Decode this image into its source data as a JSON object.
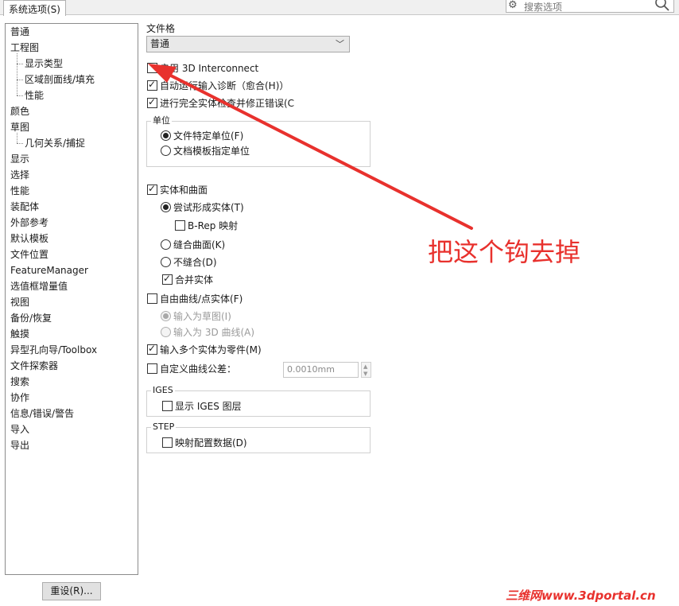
{
  "tab": {
    "label": "系统选项(S)"
  },
  "search": {
    "placeholder": "搜索选项"
  },
  "nav": {
    "items": [
      {
        "label": "普通",
        "sub": false
      },
      {
        "label": "工程图",
        "sub": false
      },
      {
        "label": "显示类型",
        "sub": true
      },
      {
        "label": "区域剖面线/填充",
        "sub": true
      },
      {
        "label": "性能",
        "sub": true
      },
      {
        "label": "颜色",
        "sub": false
      },
      {
        "label": "草图",
        "sub": false
      },
      {
        "label": "几何关系/捕捉",
        "sub": true
      },
      {
        "label": "显示",
        "sub": false
      },
      {
        "label": "选择",
        "sub": false
      },
      {
        "label": "性能",
        "sub": false
      },
      {
        "label": "装配体",
        "sub": false
      },
      {
        "label": "外部参考",
        "sub": false
      },
      {
        "label": "默认模板",
        "sub": false
      },
      {
        "label": "文件位置",
        "sub": false
      },
      {
        "label": "FeatureManager",
        "sub": false
      },
      {
        "label": "选值框增量值",
        "sub": false
      },
      {
        "label": "视图",
        "sub": false
      },
      {
        "label": "备份/恢复",
        "sub": false
      },
      {
        "label": "触摸",
        "sub": false
      },
      {
        "label": "异型孔向导/Toolbox",
        "sub": false
      },
      {
        "label": "文件探索器",
        "sub": false
      },
      {
        "label": "搜索",
        "sub": false
      },
      {
        "label": "协作",
        "sub": false
      },
      {
        "label": "信息/错误/警告",
        "sub": false
      },
      {
        "label": "导入",
        "sub": false,
        "selected": true
      },
      {
        "label": "导出",
        "sub": false
      }
    ],
    "reset_label": "重设(R)..."
  },
  "panel": {
    "file_format_label": "文件格",
    "file_format_value": "普通",
    "enable_3d_interconnect": "启用 3D Interconnect",
    "auto_diagnose": "自动运行输入诊断（愈合(H)）",
    "full_check": "进行完全实体检查并修正错误(C",
    "units_group": "单位",
    "units_file_specific": "文件特定单位(F)",
    "units_template": "文档模板指定单位",
    "solids_surfaces": "实体和曲面",
    "try_form_solid": "尝试形成实体(T)",
    "brep_mapping": "B-Rep 映射",
    "knit_surfaces": "缝合曲面(K)",
    "no_knit": "不缝合(D)",
    "merge_solids": "合并实体",
    "free_curves": "自由曲线/点实体(F)",
    "import_as_sketch": "输入为草图(I)",
    "import_as_3d_curve": "输入为 3D 曲线(A)",
    "import_multi_body": "输入多个实体为零件(M)",
    "custom_tolerance": "自定义曲线公差：",
    "tolerance_value": "0.0010mm",
    "iges_group": "IGES",
    "show_iges_layers": "显示 IGES 图层",
    "step_group": "STEP",
    "map_config_data": "映射配置数据(D)"
  },
  "annotation": {
    "text": "把这个钩去掉",
    "color": "#e8312d"
  },
  "watermark": {
    "text": "三维网www.3dportal.cn"
  }
}
